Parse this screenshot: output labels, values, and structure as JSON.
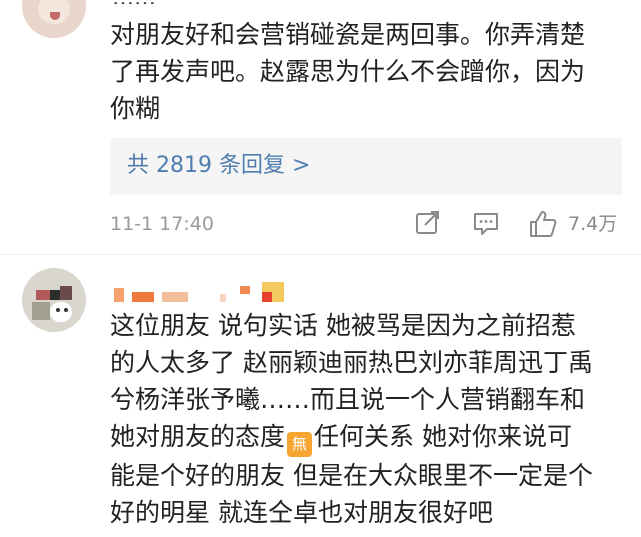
{
  "comment_1": {
    "partial_name": "……",
    "text": "对朋友好和会营销碰瓷是两回事。你弄清楚\n了再发声吧。赵露思为什么不会蹭你，因为\n你糊",
    "reply_link": "共 2819 条回复 >",
    "timestamp": "11-1 17:40",
    "like_count": "7.4万",
    "icons": [
      "share-icon",
      "comment-icon",
      "like-icon"
    ]
  },
  "comment_2": {
    "text_before_emoji": "这位朋友  说句实话  她被骂是因为之前招惹\n的人太多了  赵丽颖迪丽热巴刘亦菲周迅丁禹\n兮杨洋张予曦……而且说一个人营销翻车和\n她对朋友的态度",
    "emoji": "無",
    "text_after_emoji": "任何关系  她对你来说可\n能是个好的朋友  但是在大众眼里不一定是个\n好的明星  就连仝卓也对朋友很好吧"
  },
  "colors": {
    "link": "#507daf",
    "meta": "#9a9a9a",
    "reply_bg": "#f5f5f5",
    "emoji_bg": "#f6a530"
  }
}
